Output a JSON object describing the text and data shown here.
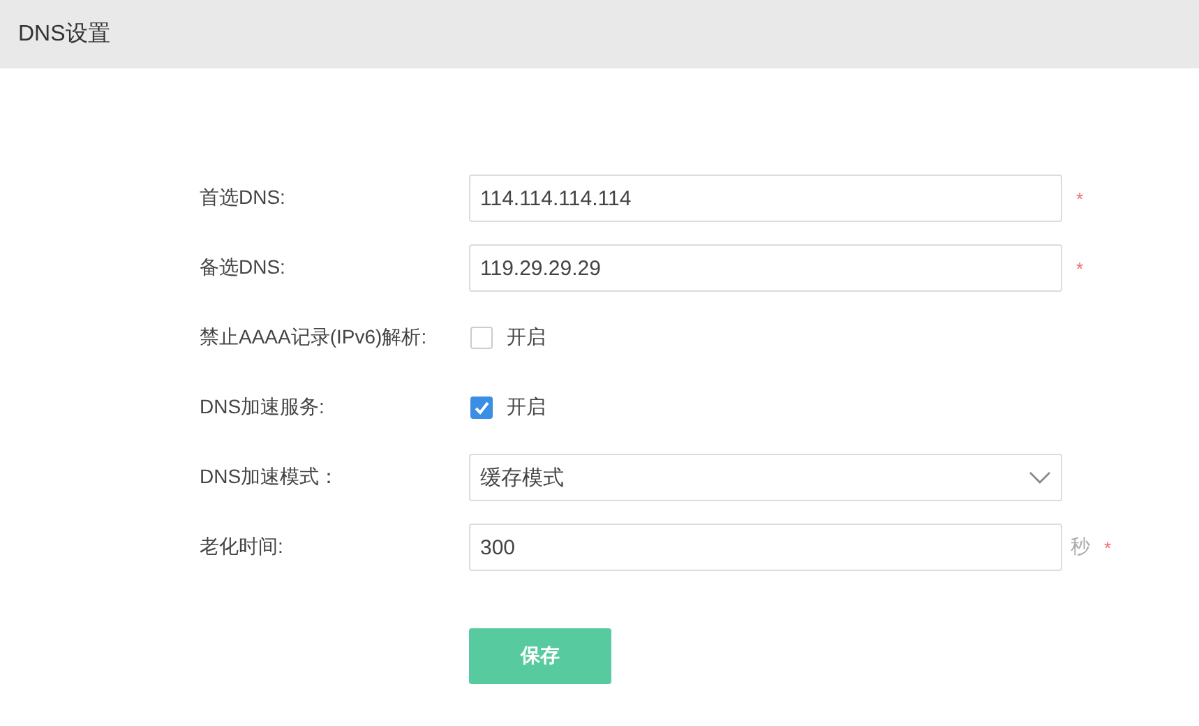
{
  "header": {
    "title": "DNS设置"
  },
  "fields": [
    {
      "kind": "text",
      "label": "首选DNS:",
      "value": "114.114.114.114",
      "required_mark": "*"
    },
    {
      "kind": "text",
      "label": "备选DNS:",
      "value": "119.29.29.29",
      "required_mark": "*"
    },
    {
      "kind": "checkbox",
      "label": "禁止AAAA记录(IPv6)解析:",
      "checked": false,
      "text": "开启"
    },
    {
      "kind": "checkbox",
      "label": "DNS加速服务:",
      "checked": true,
      "text": "开启"
    },
    {
      "kind": "select",
      "label": "DNS加速模式：",
      "value": "缓存模式"
    },
    {
      "kind": "text",
      "label": "老化时间:",
      "value": "300",
      "unit": "秒",
      "required_mark": "*"
    }
  ],
  "save_button": "保存"
}
